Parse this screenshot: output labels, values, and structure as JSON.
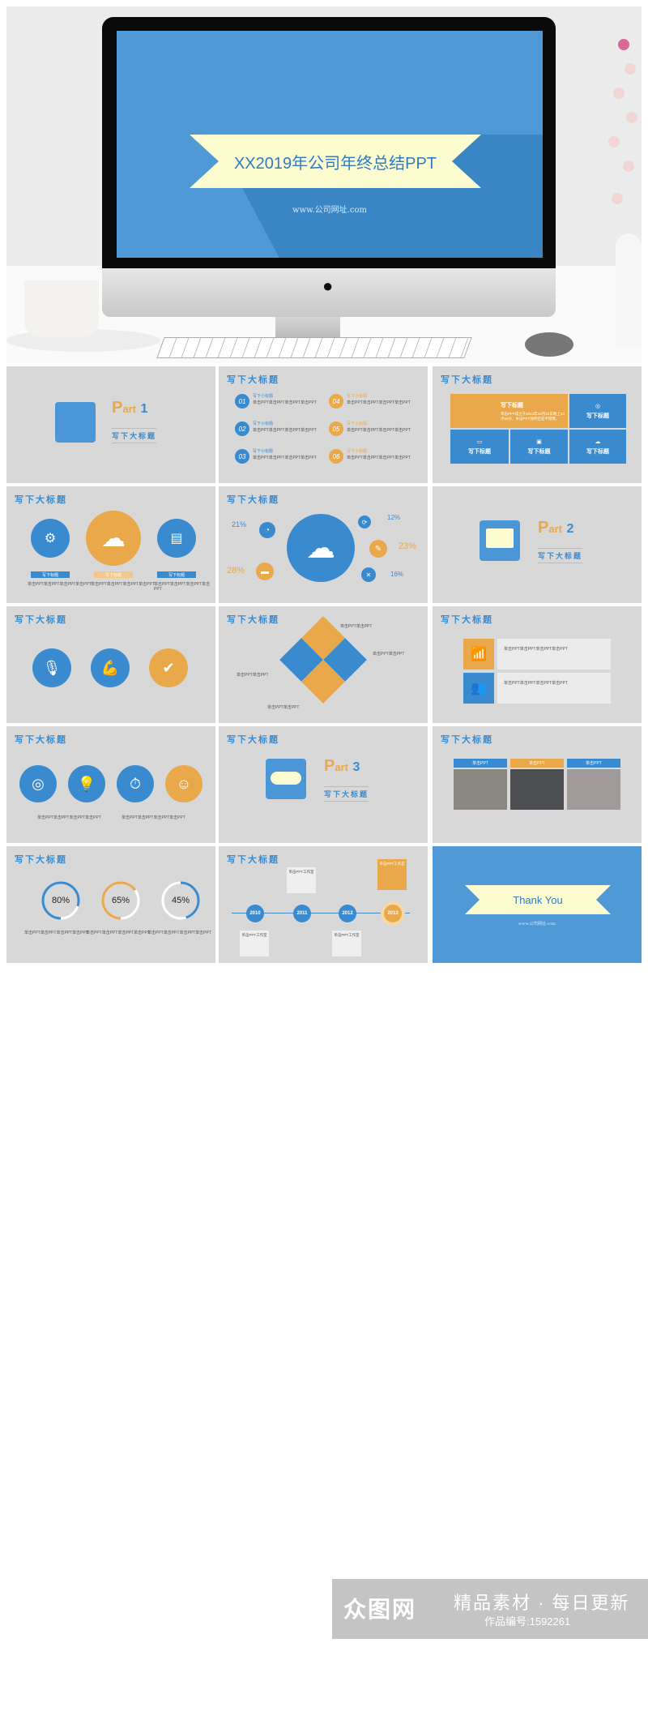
{
  "hero": {
    "title": "XX2019年公司年终总结PPT",
    "url": "www.公司网址.com",
    "apple_logo": ""
  },
  "common": {
    "slide_title": "写下大标题",
    "filler_short": "单击PPT单击PPT单击PPT单击PPT",
    "filler_two": "单击PPT单击PPT",
    "subtitle": "写下小标题",
    "tile_label": "写下标题",
    "work_text": "单击PPT工作室"
  },
  "slides": {
    "part1": {
      "part": "P",
      "art": "art",
      "num": "1",
      "sub": "写下大标题"
    },
    "numbered_list": {
      "items": [
        {
          "num": "01",
          "color": "blue"
        },
        {
          "num": "02",
          "color": "blue"
        },
        {
          "num": "03",
          "color": "blue"
        },
        {
          "num": "04",
          "color": "orange"
        },
        {
          "num": "05",
          "color": "orange"
        },
        {
          "num": "06",
          "color": "orange"
        }
      ]
    },
    "tiles": {
      "feature_title": "写下标题",
      "feature_text": "单击PPT成立于2013年10月22日晚上23点50分，本设PPT独特还是不错哦。",
      "labels": [
        "写下标题",
        "写下标题",
        "写下标题",
        "写下标题"
      ]
    },
    "three_circles": {
      "labels": [
        "写下标题",
        "写下标题",
        "写下标题"
      ]
    },
    "cloud_stats": {
      "values": [
        "21%",
        "28%",
        "12%",
        "23%",
        "16%"
      ]
    },
    "part2": {
      "part": "P",
      "art": "art",
      "num": "2",
      "sub": "写下大标题"
    },
    "part3": {
      "part": "P",
      "art": "art",
      "num": "3",
      "sub": "写下大标题"
    },
    "photos": {
      "headers": [
        "单击PPT",
        "单击PPT",
        "单击PPT"
      ]
    },
    "progress": {
      "values": [
        0.8,
        0.65,
        0.45
      ],
      "labels": [
        "80%",
        "65%",
        "45%"
      ]
    },
    "timeline": {
      "years": [
        "2010",
        "2011",
        "2012",
        "2013"
      ]
    },
    "thanks": {
      "title": "Thank  You",
      "url": "www.公司网址.com"
    }
  },
  "colors": {
    "blue": "#3a8ad0",
    "orange": "#e9a84a",
    "slide_bg": "#d8d8d8",
    "ribbon": "#fdfbd0"
  },
  "watermark": {
    "logo": "众图网",
    "slogan": "精品素材 · 每日更新",
    "work_id": "作品编号:1592261"
  }
}
